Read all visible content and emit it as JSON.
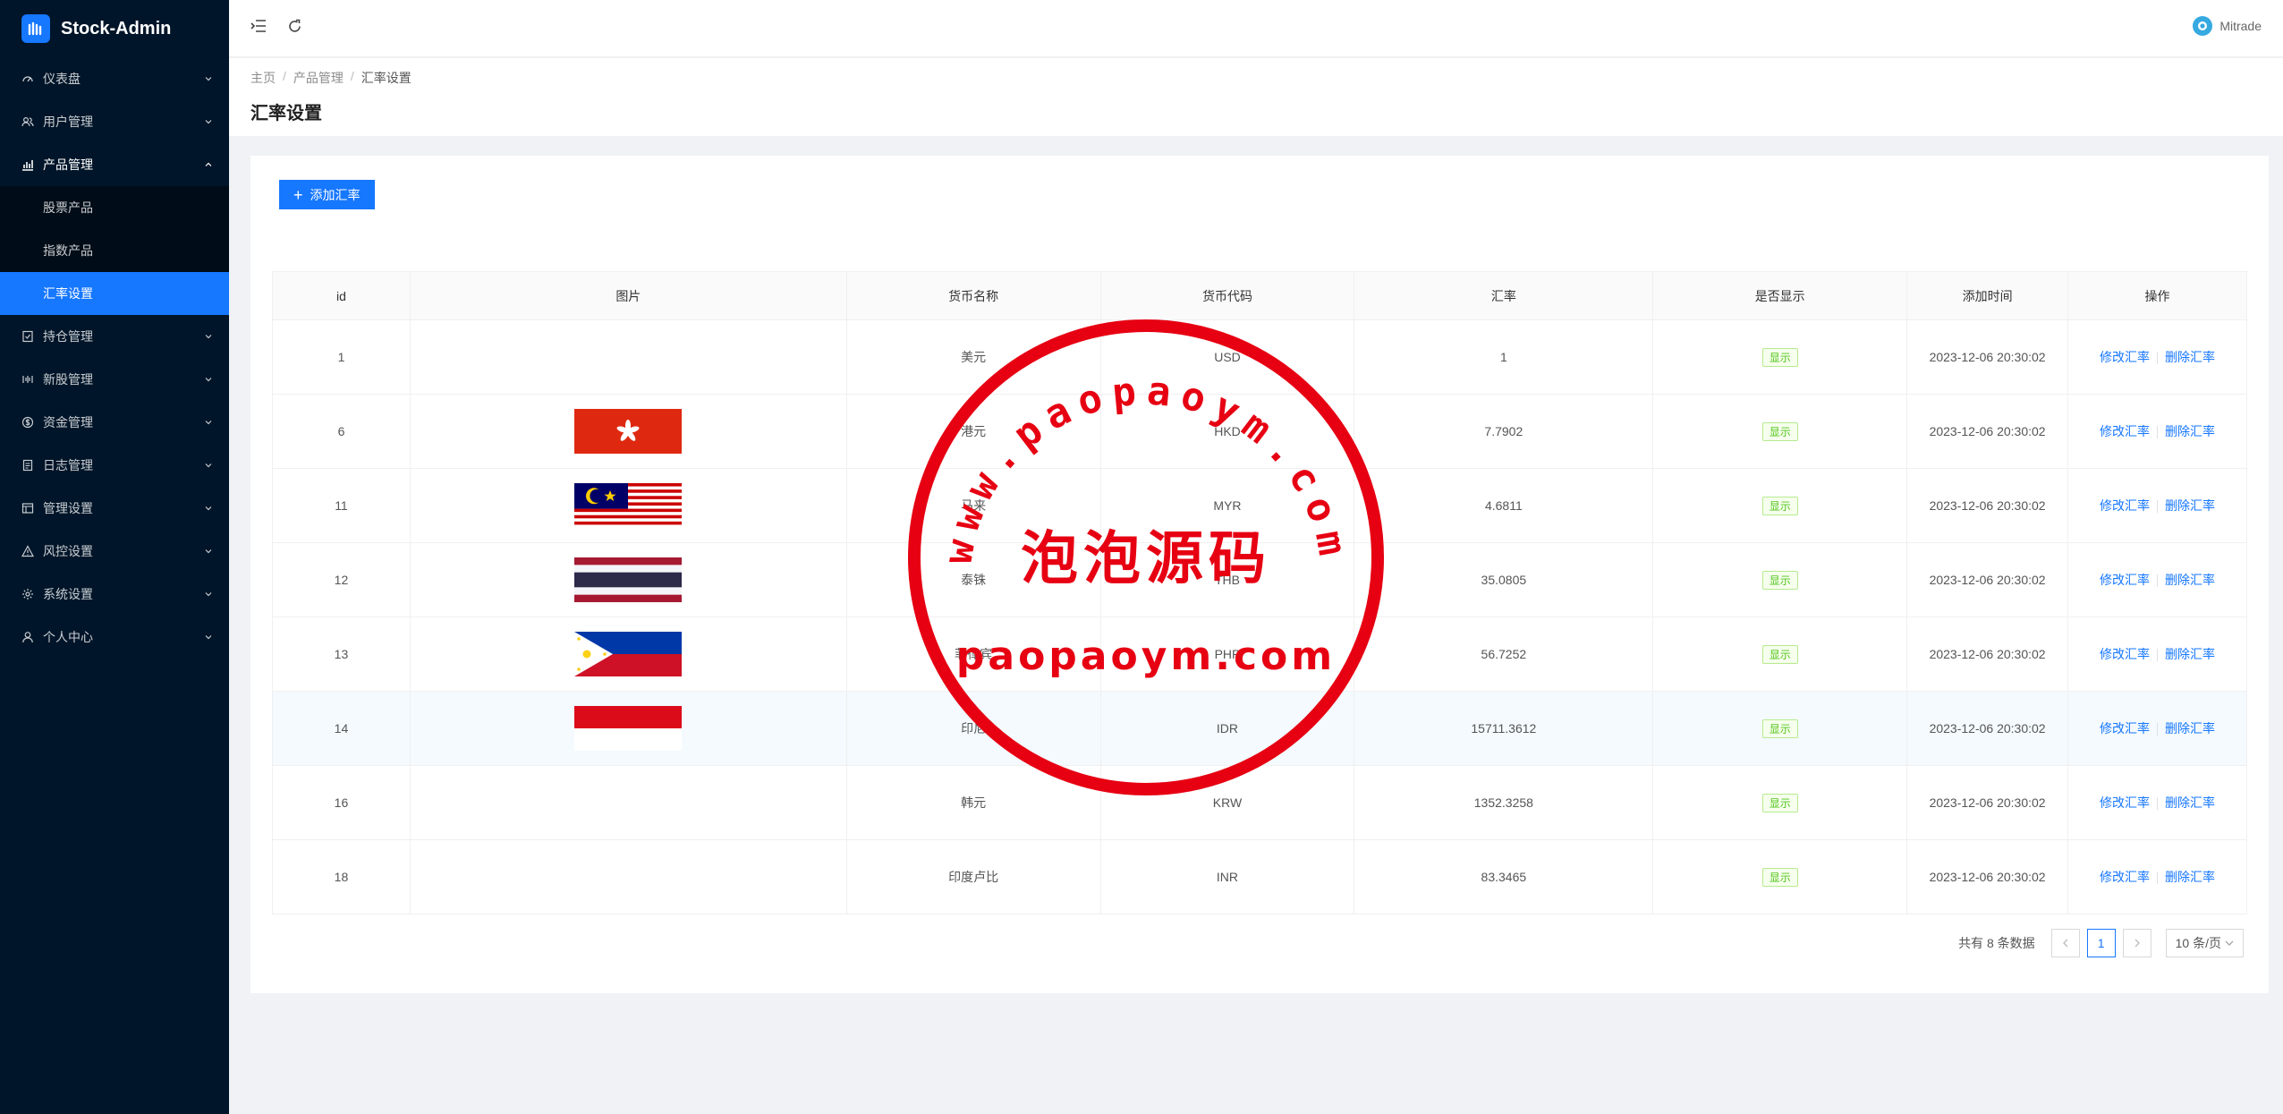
{
  "app": {
    "name": "Stock-Admin"
  },
  "sidebar": {
    "items": [
      {
        "label": "仪表盘",
        "icon": "dashboard-icon"
      },
      {
        "label": "用户管理",
        "icon": "users-icon"
      },
      {
        "label": "产品管理",
        "icon": "chart-icon",
        "open": true,
        "children": [
          {
            "label": "股票产品"
          },
          {
            "label": "指数产品"
          },
          {
            "label": "汇率设置",
            "active": true
          }
        ]
      },
      {
        "label": "持仓管理",
        "icon": "position-icon"
      },
      {
        "label": "新股管理",
        "icon": "ipo-icon"
      },
      {
        "label": "资金管理",
        "icon": "money-icon"
      },
      {
        "label": "日志管理",
        "icon": "log-icon"
      },
      {
        "label": "管理设置",
        "icon": "admin-icon"
      },
      {
        "label": "风控设置",
        "icon": "warning-icon"
      },
      {
        "label": "系统设置",
        "icon": "settings-icon"
      },
      {
        "label": "个人中心",
        "icon": "user-icon"
      }
    ]
  },
  "header": {
    "user_name": "Mitrade"
  },
  "breadcrumb": [
    "主页",
    "产品管理",
    "汇率设置"
  ],
  "page": {
    "title": "汇率设置",
    "add_button": "添加汇率"
  },
  "table": {
    "columns": [
      "id",
      "图片",
      "货币名称",
      "货币代码",
      "汇率",
      "是否显示",
      "添加时间",
      "操作"
    ],
    "rows": [
      {
        "id": "1",
        "flag": "",
        "name": "美元",
        "code": "USD",
        "rate": "1",
        "show": "显示",
        "time": "2023-12-06 20:30:02"
      },
      {
        "id": "6",
        "flag": "hong-kong-flag",
        "name": "港元",
        "code": "HKD",
        "rate": "7.7902",
        "show": "显示",
        "time": "2023-12-06 20:30:02"
      },
      {
        "id": "11",
        "flag": "malaysia-flag",
        "name": "马来",
        "code": "MYR",
        "rate": "4.6811",
        "show": "显示",
        "time": "2023-12-06 20:30:02"
      },
      {
        "id": "12",
        "flag": "thailand-flag",
        "name": "泰铢",
        "code": "THB",
        "rate": "35.0805",
        "show": "显示",
        "time": "2023-12-06 20:30:02"
      },
      {
        "id": "13",
        "flag": "philippines-flag",
        "name": "菲律宾",
        "code": "PHP",
        "rate": "56.7252",
        "show": "显示",
        "time": "2023-12-06 20:30:02"
      },
      {
        "id": "14",
        "flag": "indonesia-flag",
        "name": "印尼",
        "code": "IDR",
        "rate": "15711.3612",
        "show": "显示",
        "time": "2023-12-06 20:30:02"
      },
      {
        "id": "16",
        "flag": "",
        "name": "韩元",
        "code": "KRW",
        "rate": "1352.3258",
        "show": "显示",
        "time": "2023-12-06 20:30:02"
      },
      {
        "id": "18",
        "flag": "",
        "name": "印度卢比",
        "code": "INR",
        "rate": "83.3465",
        "show": "显示",
        "time": "2023-12-06 20:30:02"
      }
    ],
    "row_actions": {
      "edit": "修改汇率",
      "delete": "删除汇率"
    }
  },
  "pagination": {
    "total_text": "共有 8 条数据",
    "current_page": "1",
    "page_size": "10 条/页"
  },
  "watermark": {
    "arc_text": "www.paopaoym.com",
    "center_text": "泡泡源码",
    "bottom_text": "paopaoym.com"
  },
  "colors": {
    "sidebar_bg": "#001529",
    "primary": "#1677ff",
    "tag_green": "#52c41a",
    "watermark_red": "#e60012"
  }
}
